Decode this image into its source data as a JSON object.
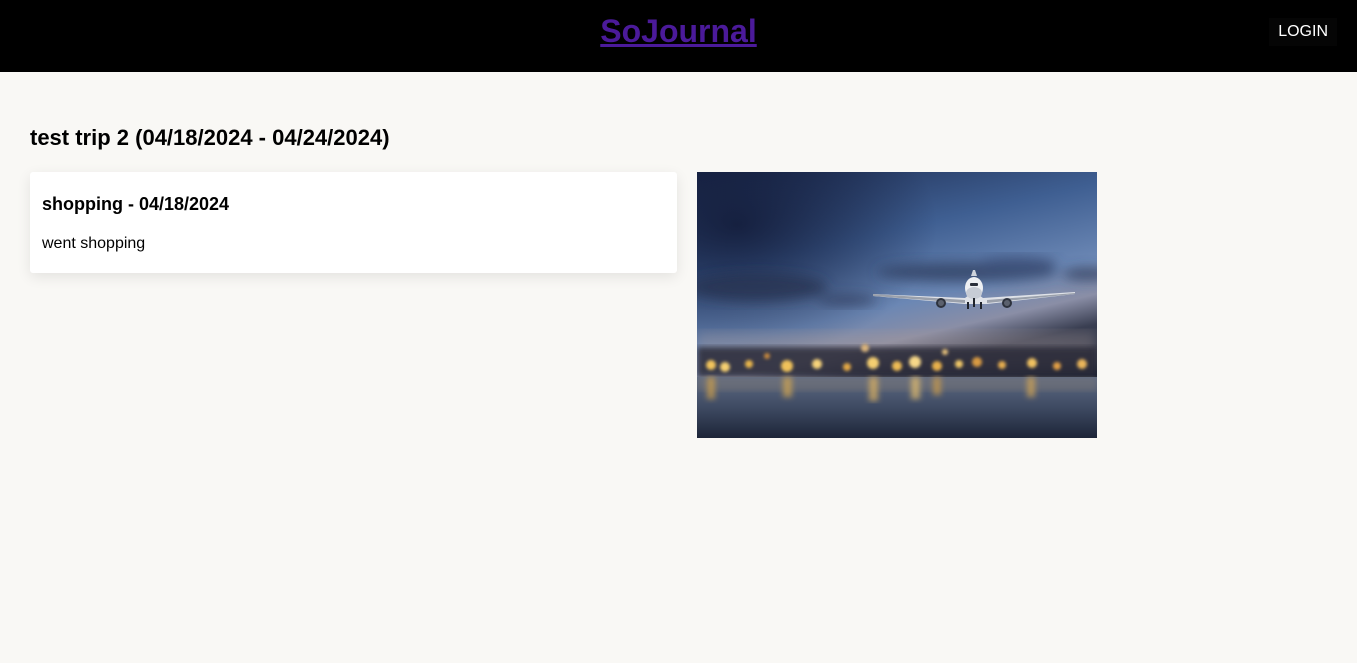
{
  "header": {
    "brand": "SoJournal",
    "login_label": "LOGIN",
    "brand_color": "#4b1a9a",
    "background": "#000000"
  },
  "trip": {
    "title": "test trip 2 (04/18/2024 - 04/24/2024)",
    "entries": [
      {
        "title": "shopping - 04/18/2024",
        "description": "went shopping"
      }
    ],
    "photo": {
      "subject": "airplane-landing-at-dusk"
    }
  },
  "page": {
    "background": "#f9f8f5"
  }
}
